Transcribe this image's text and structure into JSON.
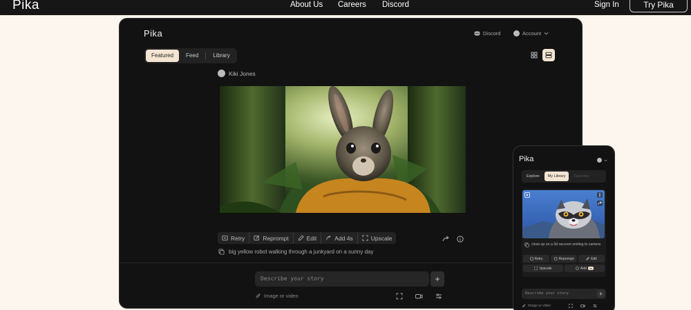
{
  "topnav": {
    "logo": "Pika",
    "links": [
      "About Us",
      "Careers",
      "Discord"
    ],
    "sign_in": "Sign In",
    "try_button": "Try Pika"
  },
  "desktop": {
    "brand": "Pika",
    "discord": "Discord",
    "account": "Account",
    "tabs": [
      "Featured",
      "Feed",
      "Library"
    ],
    "active_tab": "Featured",
    "author": "Kiki Jones",
    "actions": [
      "Retry",
      "Reprompt",
      "Edit",
      "Add 4s",
      "Upscale"
    ],
    "prompt": "big yellow robot walking through a junkyard on a sunny day",
    "story_placeholder": "Describe your story",
    "image_or_video": "Image or video"
  },
  "mobile": {
    "brand": "Pika",
    "tabs": [
      "Explore",
      "My Library",
      "Favorites"
    ],
    "active_tab": "My Library",
    "prompt": "close up on a 3d raccoon smiling to camera",
    "actions_row1": [
      "Retry",
      "Reprompt",
      "Edit"
    ],
    "actions_row2": [
      "Upscale",
      "Add"
    ],
    "add_badge": "4s",
    "story_placeholder": "Describe your story",
    "image_or_video": "Image or video"
  },
  "colors": {
    "page_bg": "#fdf6ee",
    "nav_bg": "#161616",
    "frame_bg": "#121212",
    "accent": "#f3e5d2"
  }
}
